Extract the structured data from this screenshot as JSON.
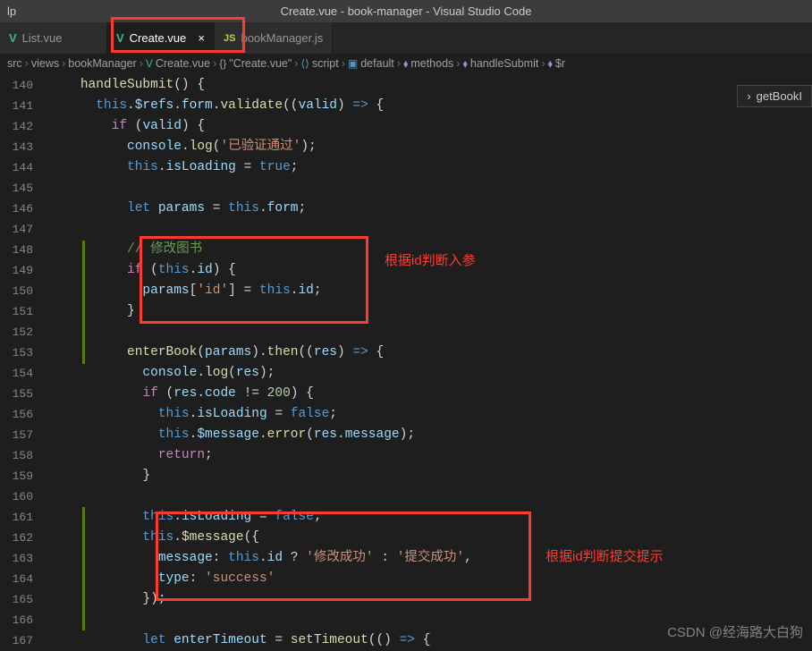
{
  "window": {
    "title": "Create.vue - book-manager - Visual Studio Code",
    "menu_left": "lp"
  },
  "tabs": [
    {
      "icon": "vue",
      "label": "List.vue",
      "active": false,
      "closable": false
    },
    {
      "icon": "vue",
      "label": "Create.vue",
      "active": true,
      "closable": true
    },
    {
      "icon": "js",
      "label": "bookManager.js",
      "active": false,
      "closable": false
    }
  ],
  "breadcrumb": {
    "items": [
      {
        "label": "src"
      },
      {
        "label": "views"
      },
      {
        "label": "bookManager"
      },
      {
        "label": "Create.vue",
        "icon": "vue"
      },
      {
        "label": "\"Create.vue\"",
        "icon": "braces"
      },
      {
        "label": "script",
        "icon": "code"
      },
      {
        "label": "default",
        "icon": "var"
      },
      {
        "label": "methods",
        "icon": "cube"
      },
      {
        "label": "handleSubmit",
        "icon": "cube"
      },
      {
        "label": "$r",
        "icon": "cube"
      }
    ]
  },
  "float_hint": "getBookI",
  "line_start": 140,
  "line_end": 167,
  "code_lines": [
    "    <y>handleSubmit</y><d>() {</d>",
    "      <b>this</b><d>.</d><lb>$refs</lb><d>.</d><lb>form</lb><d>.</d><y>validate</y><d>((</d><lb>valid</lb><d>)</d> <b>=></b> <d>{</d>",
    "        <p>if</p> <d>(</d><lb>valid</lb><d>) {</d>",
    "          <lb>console</lb><d>.</d><y>log</y><d>(</d><s>'已验证通过'</s><d>);</d>",
    "          <b>this</b><d>.</d><lb>isLoading</lb> <d>=</d> <b>true</b><d>;</d>",
    "",
    "          <b>let</b> <lb>params</lb> <d>=</d> <b>this</b><d>.</d><lb>form</lb><d>;</d>",
    "",
    "          <c>// 修改图书</c>",
    "          <p>if</p> <d>(</d><b>this</b><d>.</d><lb>id</lb><d>) {</d>",
    "            <lb>params</lb><d>[</d><s>'id'</s><d>] =</d> <b>this</b><d>.</d><lb>id</lb><d>;</d>",
    "          <d>}</d>",
    "",
    "          <y>enterBook</y><d>(</d><lb>params</lb><d>).</d><y>then</y><d>((</d><lb>res</lb><d>)</d> <b>=></b> <d>{</d>",
    "            <lb>console</lb><d>.</d><y>log</y><d>(</d><lb>res</lb><d>);</d>",
    "            <p>if</p> <d>(</d><lb>res</lb><d>.</d><lb>code</lb> <d>!=</d> <n>200</n><d>) {</d>",
    "              <b>this</b><d>.</d><lb>isLoading</lb> <d>=</d> <b>false</b><d>;</d>",
    "              <b>this</b><d>.</d><lb>$message</lb><d>.</d><y>error</y><d>(</d><lb>res</lb><d>.</d><lb>message</lb><d>);</d>",
    "              <p>return</p><d>;</d>",
    "            <d>}</d>",
    "",
    "            <b>this</b><d>.</d><lb>isLoading</lb> <d>=</d> <b>false</b><d>;</d>",
    "            <b>this</b><d>.</d><y>$message</y><d>({</d>",
    "              <lb>message</lb><d>:</d> <b>this</b><d>.</d><lb>id</lb> <d>?</d> <s>'修改成功'</s> <d>:</d> <s>'提交成功'</s><d>,</d>",
    "              <lb>type</lb><d>:</d> <s>'success'</s>",
    "            <d>});</d>",
    "",
    "            <b>let</b> <lb>enterTimeout</lb> <d>=</d> <y>setTimeout</y><d>(()</d> <b>=></b> <d>{</d>"
  ],
  "annotations": {
    "anno1": "根据id判断入参",
    "anno2": "根据id判断提交提示"
  },
  "watermark": "CSDN @经海路大白狗"
}
